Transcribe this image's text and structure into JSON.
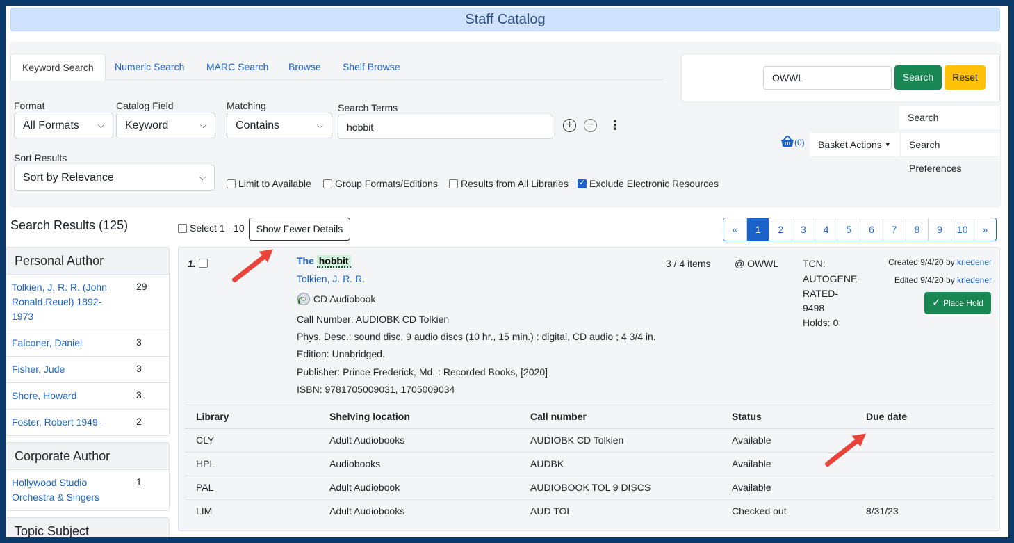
{
  "title": "Staff Catalog",
  "tabs": [
    "Keyword Search",
    "Numeric Search",
    "MARC Search",
    "Browse",
    "Shelf Browse"
  ],
  "form": {
    "format_label": "Format",
    "format_value": "All Formats",
    "field_label": "Catalog Field",
    "field_value": "Keyword",
    "matching_label": "Matching",
    "matching_value": "Contains",
    "terms_label": "Search Terms",
    "terms_value": "hobbit",
    "sort_label": "Sort Results",
    "sort_value": "Sort by Relevance",
    "limit_available": "Limit to Available",
    "group_formats": "Group Formats/Editions",
    "all_libraries": "Results from All Libraries",
    "exclude_electronic": "Exclude Electronic Resources",
    "exclude_electronic_checked": true
  },
  "side": {
    "library_value": "OWWL",
    "search_label": "Search",
    "reset_label": "Reset",
    "search_templates": "Search Templates",
    "basket_count": "(0)",
    "basket_actions": "Basket Actions",
    "search_preferences": "Search Preferences"
  },
  "results": {
    "title": "Search Results (125)",
    "select_label": "Select 1 - 10",
    "fewer_details": "Show Fewer Details",
    "pages": [
      "«",
      "1",
      "2",
      "3",
      "4",
      "5",
      "6",
      "7",
      "8",
      "9",
      "10",
      "»"
    ],
    "active_page": "1"
  },
  "facets": {
    "personal_author": {
      "heading": "Personal Author",
      "items": [
        {
          "name": "Tolkien, J. R. R. (John Ronald Reuel) 1892-1973",
          "count": "29"
        },
        {
          "name": "Falconer, Daniel",
          "count": "3"
        },
        {
          "name": "Fisher, Jude",
          "count": "3"
        },
        {
          "name": "Shore, Howard",
          "count": "3"
        },
        {
          "name": "Foster, Robert 1949-",
          "count": "2"
        }
      ]
    },
    "corporate_author": {
      "heading": "Corporate Author",
      "items": [
        {
          "name": "Hollywood Studio Orchestra & Singers",
          "count": "1"
        }
      ]
    },
    "topic_subject": {
      "heading": "Topic Subject"
    }
  },
  "record": {
    "index": "1.",
    "title_prefix": "The",
    "title_highlight": "hobbit",
    "author": "Tolkien, J. R. R.",
    "format": "CD Audiobook",
    "call_number": "Call Number: AUDIOBK CD Tolkien",
    "phys_desc": "Phys. Desc.: sound disc, 9 audio discs (10 hr., 15 min.) : digital, CD audio ; 4 3/4 in.",
    "edition": "Edition: Unabridged.",
    "publisher": "Publisher: Prince Frederick, Md. : Recorded Books, [2020]",
    "isbn": "ISBN: 9781705009031, 1705009034",
    "items": "3 / 4 items",
    "library": "@ OWWL",
    "tcn_1": "TCN:",
    "tcn_2": "AUTOGENE",
    "tcn_3": "RATED-",
    "tcn_4": "9498",
    "holds": "Holds: 0",
    "created_prefix": "Created 9/4/20 by",
    "created_by": "kriedener",
    "edited_prefix": "Edited 9/4/20 by",
    "edited_by": "kriedener",
    "place_hold": "Place Hold"
  },
  "holdings": {
    "headers": [
      "Library",
      "Shelving location",
      "Call number",
      "Status",
      "Due date"
    ],
    "rows": [
      [
        "CLY",
        "Adult Audiobooks",
        "AUDIOBK CD Tolkien",
        "Available",
        ""
      ],
      [
        "HPL",
        "Audiobooks",
        "AUDBK",
        "Available",
        ""
      ],
      [
        "PAL",
        "Adult Audiobook",
        "AUDIOBOOK TOL 9 DISCS",
        "Available",
        ""
      ],
      [
        "LIM",
        "Adult Audiobooks",
        "AUD TOL",
        "Checked out",
        "8/31/23"
      ]
    ]
  },
  "colors": {
    "primary": "#1a62c7",
    "success": "#198754",
    "warning": "#ffc107",
    "arrow": "#e8443a",
    "frame": "#0b3a6b"
  }
}
